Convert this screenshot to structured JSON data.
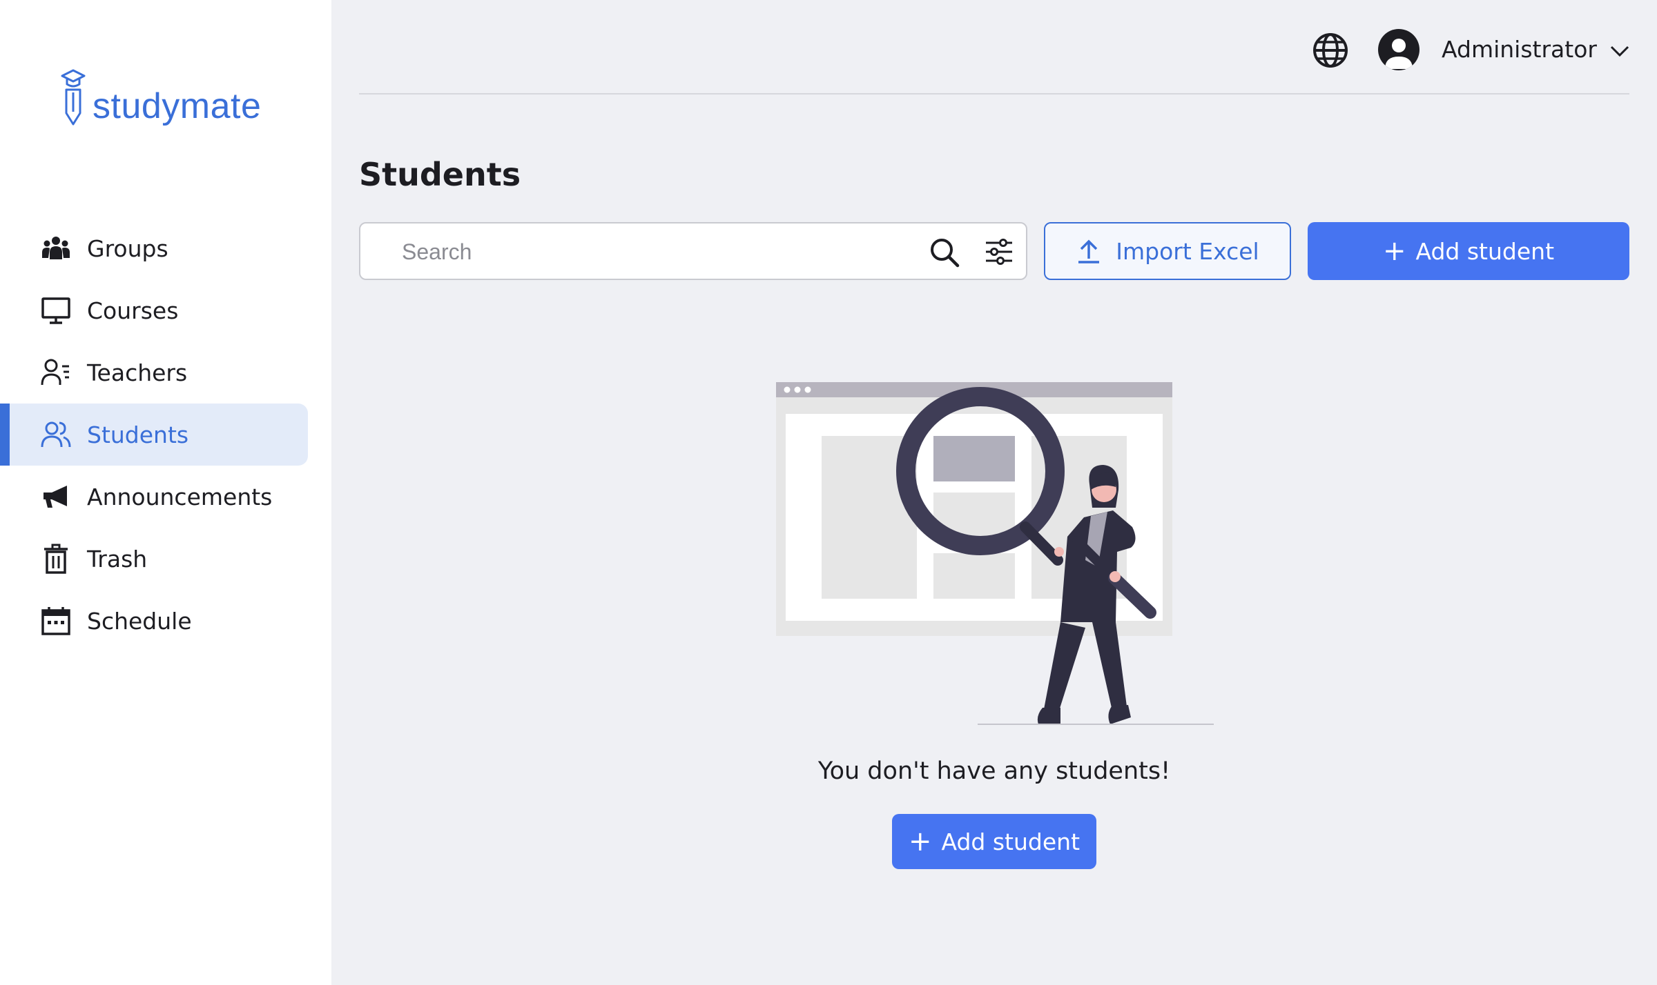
{
  "app": {
    "logo_text": "studymate",
    "brand_color": "#3a6fd8",
    "accent_button_color": "#4674f1"
  },
  "sidebar": {
    "items": [
      {
        "label": "Groups",
        "icon": "groups-icon",
        "active": false
      },
      {
        "label": "Courses",
        "icon": "monitor-icon",
        "active": false
      },
      {
        "label": "Teachers",
        "icon": "teacher-icon",
        "active": false
      },
      {
        "label": "Students",
        "icon": "students-icon",
        "active": true
      },
      {
        "label": "Announcements",
        "icon": "megaphone-icon",
        "active": false
      },
      {
        "label": "Trash",
        "icon": "trash-icon",
        "active": false
      },
      {
        "label": "Schedule",
        "icon": "calendar-icon",
        "active": false
      }
    ]
  },
  "header": {
    "user_name": "Administrator",
    "language_icon": "globe-icon",
    "menu_icon": "chevron-down-icon"
  },
  "main": {
    "title": "Students",
    "search": {
      "placeholder": "Search",
      "value": ""
    },
    "import_label": "Import Excel",
    "add_label": "Add student",
    "empty_message": "You don't have any students!",
    "empty_add_label": "Add student"
  }
}
